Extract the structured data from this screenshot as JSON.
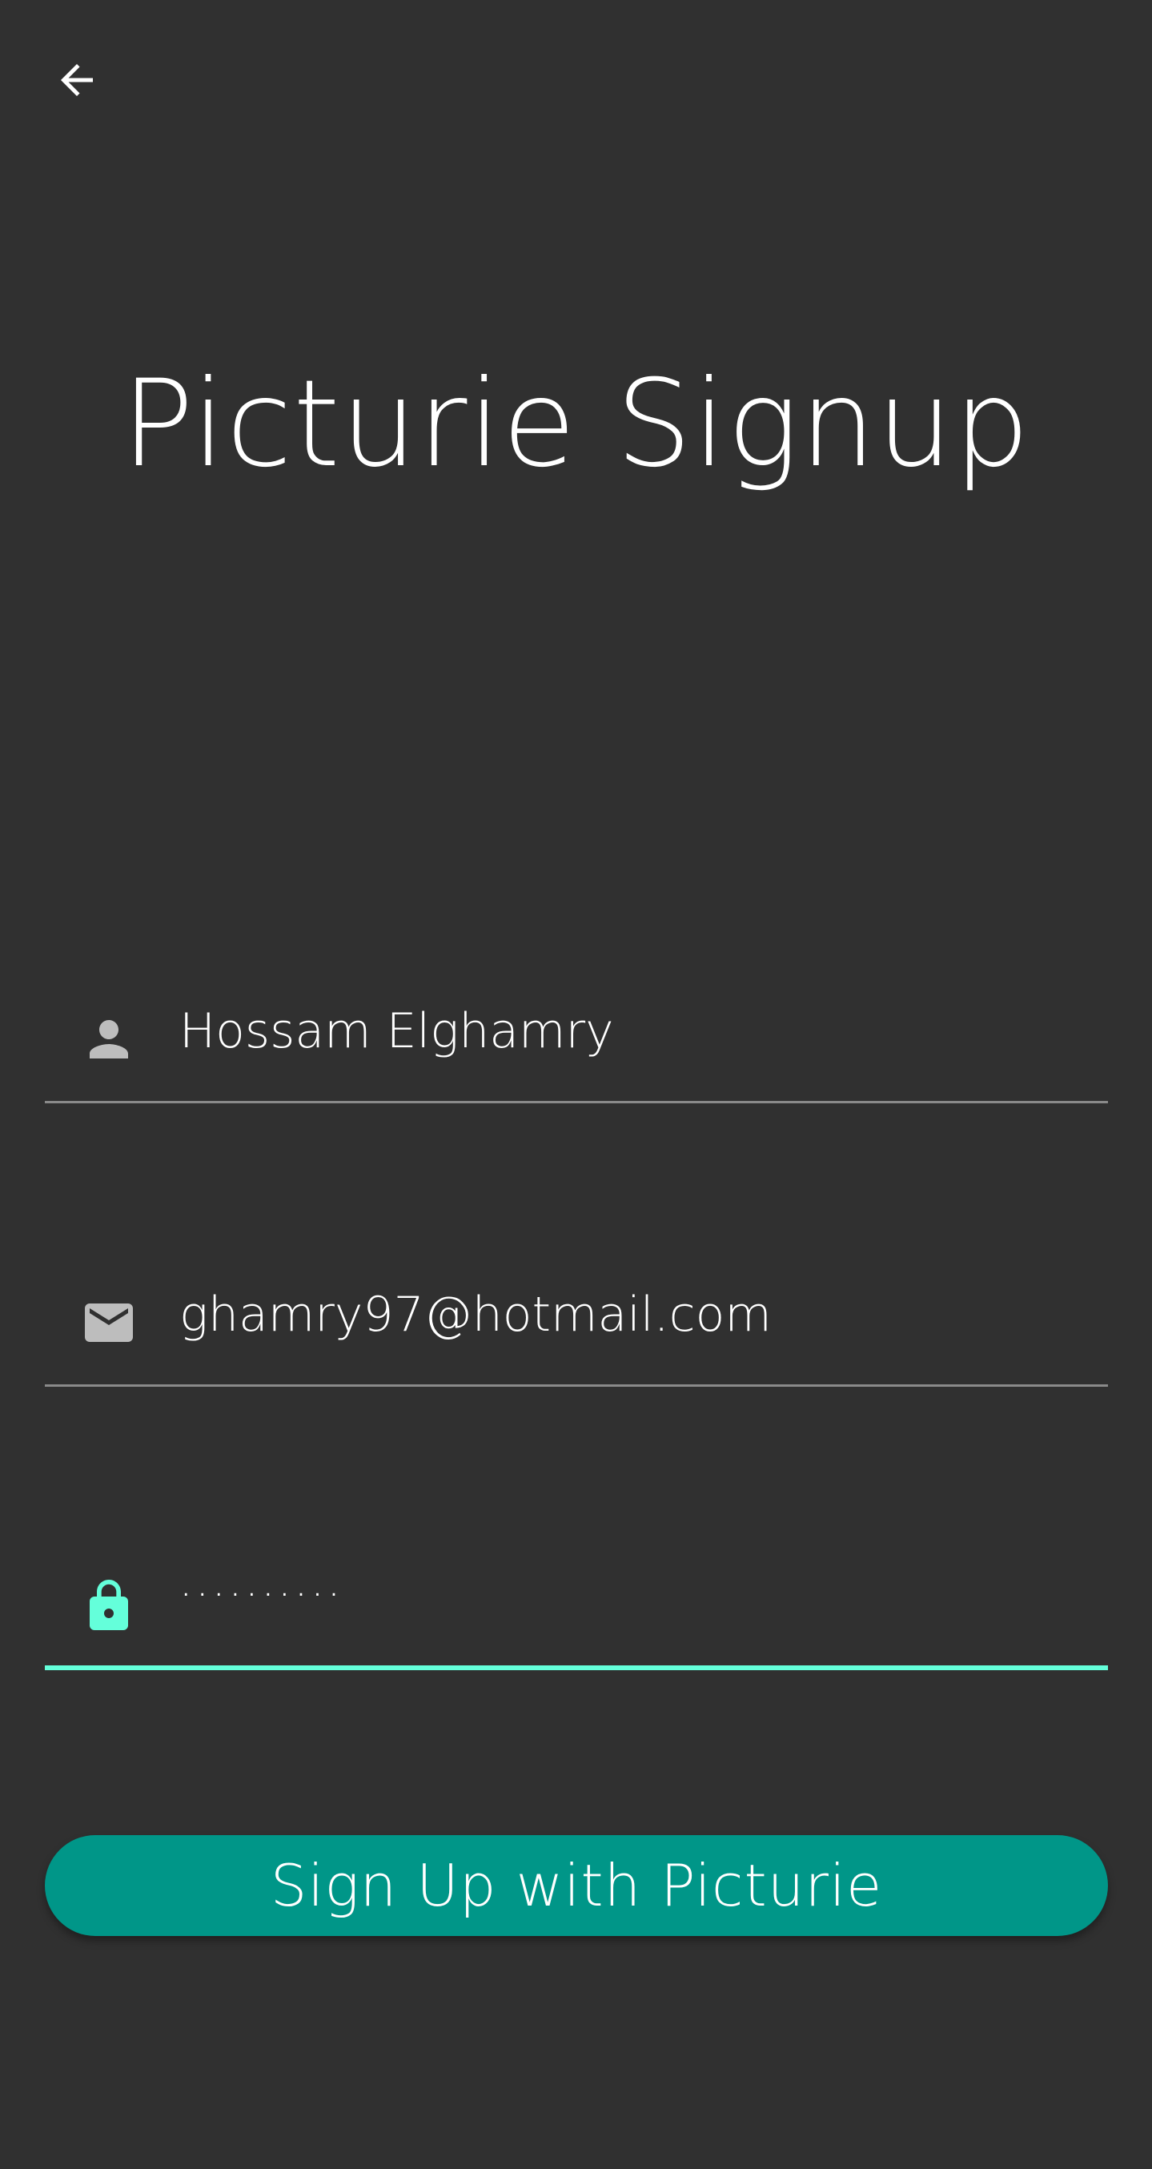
{
  "header": {
    "back_icon": "arrow-back-icon"
  },
  "title": "Picturie Signup",
  "form": {
    "name": {
      "icon": "person-icon",
      "value": "Hossam Elghamry"
    },
    "email": {
      "icon": "mail-icon",
      "value": "ghamry97@hotmail.com"
    },
    "password": {
      "icon": "lock-icon",
      "value": "··········",
      "focused": true
    }
  },
  "signup_button": {
    "label": "Sign Up with Picturie"
  },
  "colors": {
    "background": "#303030",
    "accent": "#64ffda",
    "button": "#009688",
    "icon_inactive": "#bdbdbd",
    "underline": "#8a8a8a"
  }
}
